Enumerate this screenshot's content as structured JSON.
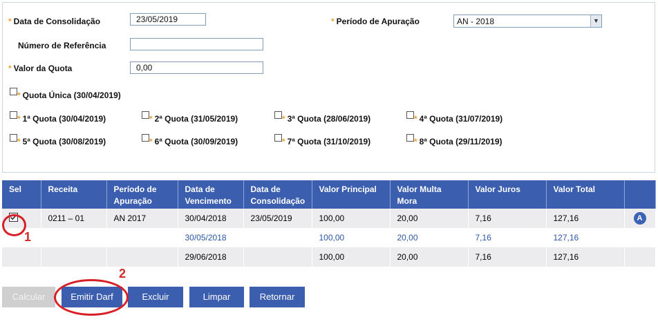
{
  "form": {
    "data_consolidacao_label": "Data de Consolidação",
    "data_consolidacao_value": "23/05/2019",
    "periodo_label": "Período de Apuração",
    "periodo_value": "AN - 2018",
    "numero_ref_label": "Número de Referência",
    "numero_ref_value": "",
    "valor_quota_label": "Valor da Quota",
    "valor_quota_value": "0,00",
    "required_mark": "*",
    "quota_unica": "Quota Única (30/04/2019)",
    "quotas": [
      "1ª Quota (30/04/2019)",
      "2ª Quota (31/05/2019)",
      "3ª Quota (28/06/2019)",
      "4ª Quota (31/07/2019)",
      "5ª Quota (30/08/2019)",
      "6ª Quota (30/09/2019)",
      "7ª Quota (31/10/2019)",
      "8ª Quota (29/11/2019)"
    ]
  },
  "table": {
    "headers": {
      "sel": "Sel",
      "receita": "Receita",
      "periodo_1": "Período de",
      "periodo_2": "Apuração",
      "venc_1": "Data de",
      "venc_2": "Vencimento",
      "cons_1": "Data de",
      "cons_2": "Consolidação",
      "principal": "Valor Principal",
      "multa_1": "Valor Multa",
      "multa_2": "Mora",
      "juros": "Valor Juros",
      "total": "Valor Total"
    },
    "rows": [
      {
        "receita": "0211 – 01",
        "periodo": "AN 2017",
        "vencimento": "30/04/2018",
        "consolidacao": "23/05/2019",
        "principal": "100,00",
        "multa": "20,00",
        "juros": "7,16",
        "total": "127,16",
        "badge": "A",
        "checked": true
      },
      {
        "receita": "",
        "periodo": "",
        "vencimento": "30/05/2018",
        "consolidacao": "",
        "principal": "100,00",
        "multa": "20,00",
        "juros": "7,16",
        "total": "127,16"
      },
      {
        "receita": "",
        "periodo": "",
        "vencimento": "29/06/2018",
        "consolidacao": "",
        "principal": "100,00",
        "multa": "20,00",
        "juros": "7,16",
        "total": "127,16"
      }
    ]
  },
  "buttons": {
    "calcular": "Calcular",
    "emitir": "Emitir Darf",
    "excluir": "Excluir",
    "limpar": "Limpar",
    "retornar": "Retornar"
  },
  "annotations": {
    "n1": "1",
    "n2": "2"
  },
  "colors": {
    "header_blue": "#3b5fae",
    "accent_star": "#f0a030",
    "annotation_red": "#d81f26"
  }
}
